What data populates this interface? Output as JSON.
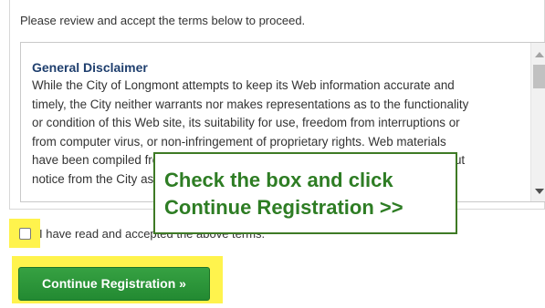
{
  "instructions": "Please review and accept the terms below to proceed.",
  "terms": {
    "heading": "General Disclaimer",
    "lines": [
      "While the City of Longmont attempts to keep its Web information accurate and",
      "timely, the City neither warrants nor makes representations as to the functionality",
      "or condition of this Web site, its suitability for use, freedom from interruptions or",
      "from computer virus, or non-infringement of proprietary rights. Web materials",
      "have been compiled from a variety of sources and are subject to change without",
      "notice from the City as a result of updates and corrections."
    ]
  },
  "callout": {
    "line1": "Check the box and click",
    "line2": "Continue Registration >>"
  },
  "checkbox": {
    "label": "I have read and accepted the above terms.",
    "checked": false
  },
  "continue_button": {
    "label": "Continue Registration »"
  },
  "colors": {
    "highlight": "#fff34d",
    "button_green": "#2a9238",
    "callout_green": "#2e7d24",
    "heading_blue": "#1f3f6e"
  }
}
